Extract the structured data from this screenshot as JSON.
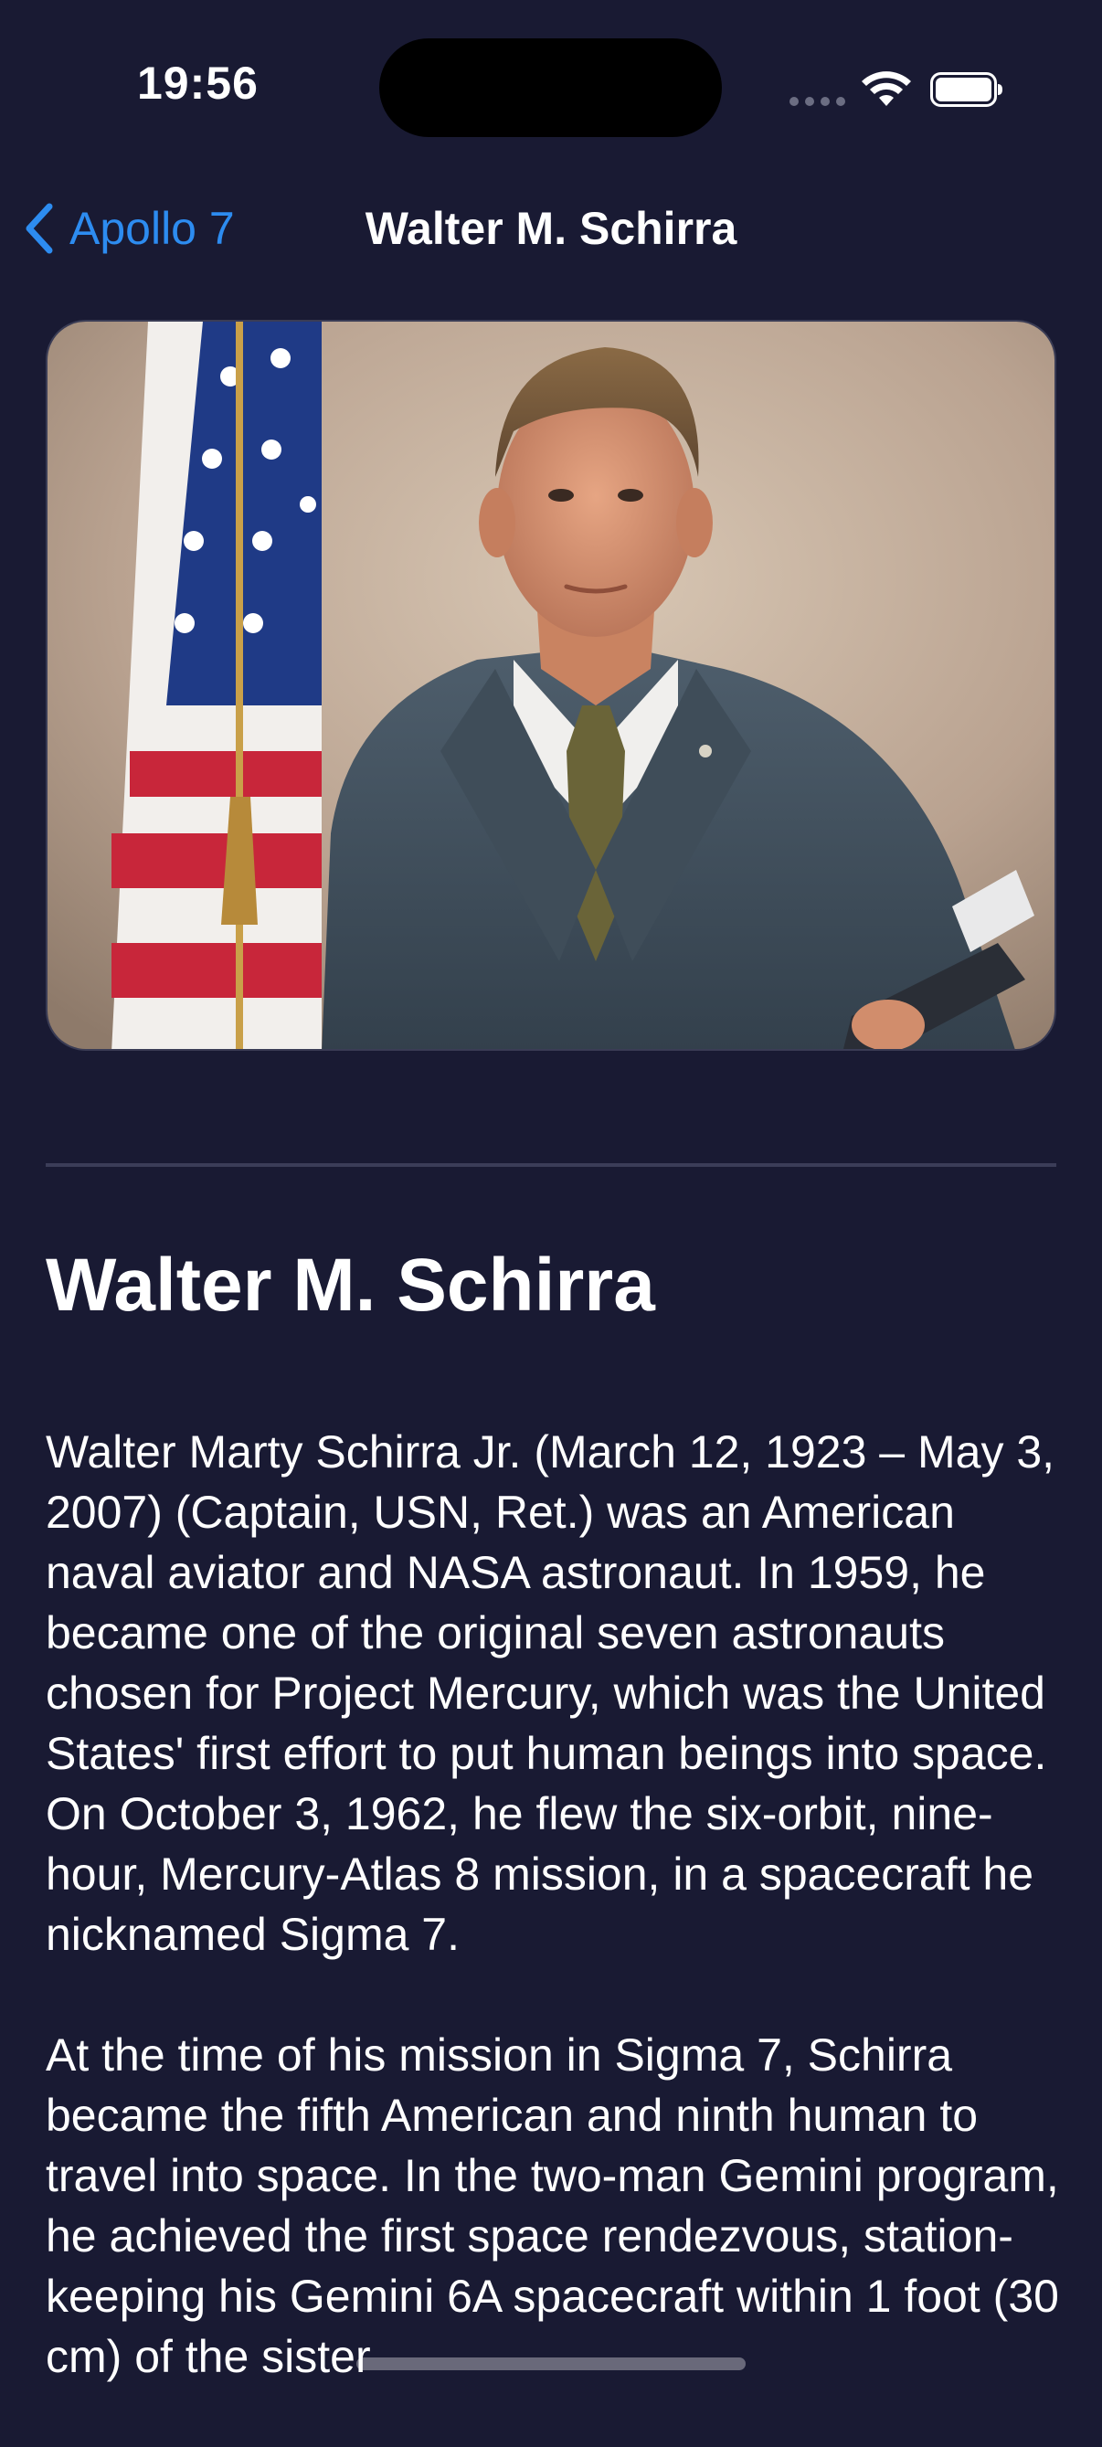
{
  "status_bar": {
    "time": "19:56"
  },
  "nav": {
    "back_label": "Apollo 7",
    "title": "Walter M. Schirra"
  },
  "profile": {
    "name": "Walter M. Schirra",
    "bio": [
      "Walter Marty Schirra Jr. (March 12, 1923 – May 3, 2007) (Captain, USN, Ret.) was an American naval aviator and NASA astronaut. In 1959, he became one of the original seven astronauts chosen for Project Mercury, which was the United States' first effort to put human beings into space. On October 3, 1962, he flew the six-orbit, nine-hour, Mercury-Atlas 8 mission, in a spacecraft he nicknamed Sigma 7.",
      "At the time of his mission in Sigma 7, Schirra became the fifth American and ninth human to travel into space. In the two-man Gemini program, he achieved the first space rendezvous, station-keeping his Gemini 6A spacecraft within 1 foot (30 cm) of the sister"
    ]
  },
  "icons": {
    "back": "chevron-left-icon",
    "wifi": "wifi-icon",
    "battery": "battery-icon",
    "signal": "cellular-signal-icon"
  },
  "colors": {
    "background": "#191a33",
    "accent": "#2d8cf0",
    "text": "#ffffff",
    "divider": "#3b3d58"
  }
}
